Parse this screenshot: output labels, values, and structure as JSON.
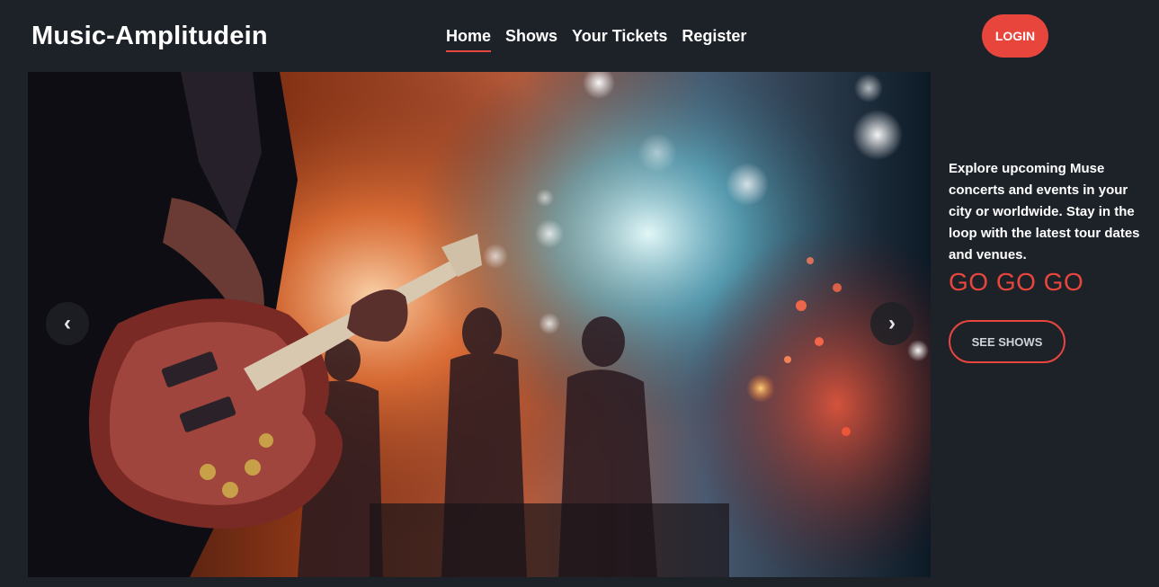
{
  "header": {
    "brand": "Music-Amplitudein",
    "nav": [
      {
        "label": "Home",
        "active": true
      },
      {
        "label": "Shows",
        "active": false
      },
      {
        "label": "Your Tickets",
        "active": false
      },
      {
        "label": "Register",
        "active": false
      }
    ],
    "login_label": "LOGIN"
  },
  "carousel": {
    "prev_icon": "‹",
    "next_icon": "›"
  },
  "side": {
    "description": "Explore upcoming Muse concerts and events in your city or worldwide. Stay in the loop with the latest tour dates and venues.",
    "slogan": "GO GO GO",
    "cta_label": "SEE SHOWS"
  },
  "colors": {
    "background": "#1d2229",
    "accent": "#e8453c"
  }
}
